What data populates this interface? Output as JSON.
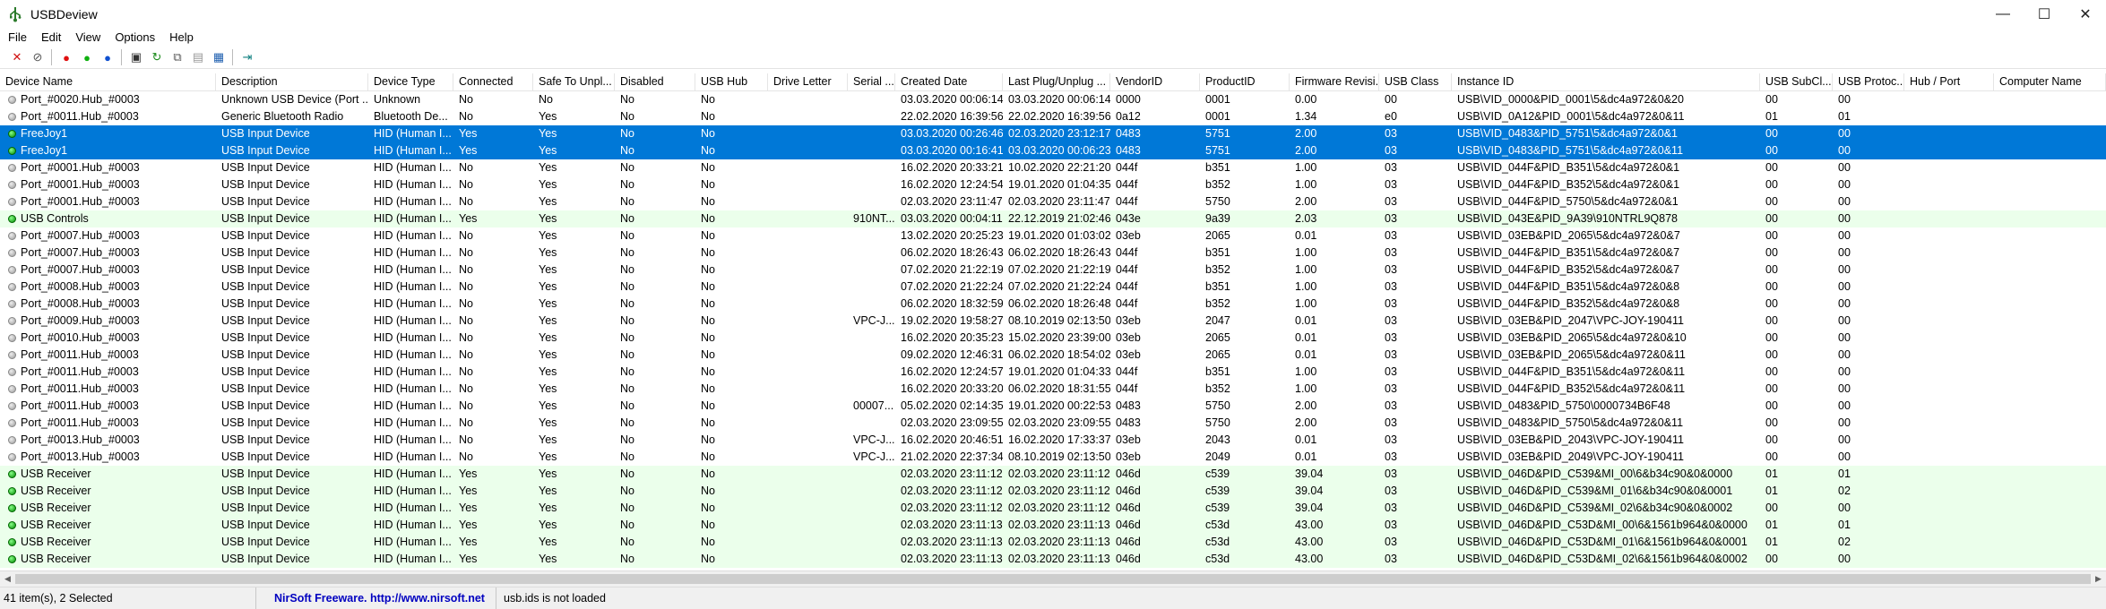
{
  "window": {
    "title": "USBDeview",
    "minimize": "—",
    "maximize": "☐",
    "close": "✕"
  },
  "menu": [
    "File",
    "Edit",
    "View",
    "Options",
    "Help"
  ],
  "toolbar": [
    {
      "name": "delete-icon",
      "glyph": "✕",
      "color": "#d01010"
    },
    {
      "name": "uninstall-icon",
      "glyph": "⊘",
      "color": "#555"
    },
    {
      "name": "disconnect-red-icon",
      "glyph": "●",
      "color": "#e01010"
    },
    {
      "name": "enable-green-icon",
      "glyph": "●",
      "color": "#10b010"
    },
    {
      "name": "blue-dot-icon",
      "glyph": "●",
      "color": "#1050d0"
    },
    {
      "name": "save-icon",
      "glyph": "▣",
      "color": "#333"
    },
    {
      "name": "refresh-icon",
      "glyph": "↻",
      "color": "#1a8a1a"
    },
    {
      "name": "copy-icon",
      "glyph": "⧉",
      "color": "#555"
    },
    {
      "name": "report-icon",
      "glyph": "▤",
      "color": "#999"
    },
    {
      "name": "properties-icon",
      "glyph": "▦",
      "color": "#2060b0"
    },
    {
      "name": "exit-icon",
      "glyph": "⇥",
      "color": "#108080"
    }
  ],
  "columns": [
    "Device Name",
    "Description",
    "Device Type",
    "Connected",
    "Safe To Unpl...",
    "Disabled",
    "USB Hub",
    "Drive Letter",
    "Serial ...",
    "Created Date",
    "Last Plug/Unplug ...",
    "VendorID",
    "ProductID",
    "Firmware Revisi...",
    "USB Class",
    "Instance ID",
    "USB SubCl...",
    "USB Protoc...",
    "Hub / Port",
    "Computer Name"
  ],
  "rows": [
    {
      "status": "gray",
      "style": "",
      "cells": [
        "Port_#0020.Hub_#0003",
        "Unknown USB Device (Port ...",
        "Unknown",
        "No",
        "No",
        "No",
        "No",
        "",
        "",
        "03.03.2020 00:06:14",
        "03.03.2020 00:06:14",
        "0000",
        "0001",
        "0.00",
        "00",
        "USB\\VID_0000&PID_0001\\5&dc4a972&0&20",
        "00",
        "00",
        "",
        ""
      ]
    },
    {
      "status": "gray",
      "style": "",
      "cells": [
        "Port_#0011.Hub_#0003",
        "Generic Bluetooth Radio",
        "Bluetooth De...",
        "No",
        "Yes",
        "No",
        "No",
        "",
        "",
        "22.02.2020 16:39:56",
        "22.02.2020 16:39:56",
        "0a12",
        "0001",
        "1.34",
        "e0",
        "USB\\VID_0A12&PID_0001\\5&dc4a972&0&11",
        "01",
        "01",
        "",
        ""
      ]
    },
    {
      "status": "green",
      "style": "selected",
      "cells": [
        "FreeJoy1",
        "USB Input Device",
        "HID (Human I...",
        "Yes",
        "Yes",
        "No",
        "No",
        "",
        "",
        "03.03.2020 00:26:46",
        "02.03.2020 23:12:17",
        "0483",
        "5751",
        "2.00",
        "03",
        "USB\\VID_0483&PID_5751\\5&dc4a972&0&1",
        "00",
        "00",
        "",
        ""
      ]
    },
    {
      "status": "green",
      "style": "selected",
      "cells": [
        "FreeJoy1",
        "USB Input Device",
        "HID (Human I...",
        "Yes",
        "Yes",
        "No",
        "No",
        "",
        "",
        "03.03.2020 00:16:41",
        "03.03.2020 00:06:23",
        "0483",
        "5751",
        "2.00",
        "03",
        "USB\\VID_0483&PID_5751\\5&dc4a972&0&11",
        "00",
        "00",
        "",
        ""
      ]
    },
    {
      "status": "gray",
      "style": "",
      "cells": [
        "Port_#0001.Hub_#0003",
        "USB Input Device",
        "HID (Human I...",
        "No",
        "Yes",
        "No",
        "No",
        "",
        "",
        "16.02.2020 20:33:21",
        "10.02.2020 22:21:20",
        "044f",
        "b351",
        "1.00",
        "03",
        "USB\\VID_044F&PID_B351\\5&dc4a972&0&1",
        "00",
        "00",
        "",
        ""
      ]
    },
    {
      "status": "gray",
      "style": "",
      "cells": [
        "Port_#0001.Hub_#0003",
        "USB Input Device",
        "HID (Human I...",
        "No",
        "Yes",
        "No",
        "No",
        "",
        "",
        "16.02.2020 12:24:54",
        "19.01.2020 01:04:35",
        "044f",
        "b352",
        "1.00",
        "03",
        "USB\\VID_044F&PID_B352\\5&dc4a972&0&1",
        "00",
        "00",
        "",
        ""
      ]
    },
    {
      "status": "gray",
      "style": "",
      "cells": [
        "Port_#0001.Hub_#0003",
        "USB Input Device",
        "HID (Human I...",
        "No",
        "Yes",
        "No",
        "No",
        "",
        "",
        "02.03.2020 23:11:47",
        "02.03.2020 23:11:47",
        "044f",
        "5750",
        "2.00",
        "03",
        "USB\\VID_044F&PID_5750\\5&dc4a972&0&1",
        "00",
        "00",
        "",
        ""
      ]
    },
    {
      "status": "green",
      "style": "green",
      "cells": [
        "USB Controls",
        "USB Input Device",
        "HID (Human I...",
        "Yes",
        "Yes",
        "No",
        "No",
        "",
        "910NT...",
        "03.03.2020 00:04:11",
        "22.12.2019 21:02:46",
        "043e",
        "9a39",
        "2.03",
        "03",
        "USB\\VID_043E&PID_9A39\\910NTRL9Q878",
        "00",
        "00",
        "",
        ""
      ]
    },
    {
      "status": "gray",
      "style": "",
      "cells": [
        "Port_#0007.Hub_#0003",
        "USB Input Device",
        "HID (Human I...",
        "No",
        "Yes",
        "No",
        "No",
        "",
        "",
        "13.02.2020 20:25:23",
        "19.01.2020 01:03:02",
        "03eb",
        "2065",
        "0.01",
        "03",
        "USB\\VID_03EB&PID_2065\\5&dc4a972&0&7",
        "00",
        "00",
        "",
        ""
      ]
    },
    {
      "status": "gray",
      "style": "",
      "cells": [
        "Port_#0007.Hub_#0003",
        "USB Input Device",
        "HID (Human I...",
        "No",
        "Yes",
        "No",
        "No",
        "",
        "",
        "06.02.2020 18:26:43",
        "06.02.2020 18:26:43",
        "044f",
        "b351",
        "1.00",
        "03",
        "USB\\VID_044F&PID_B351\\5&dc4a972&0&7",
        "00",
        "00",
        "",
        ""
      ]
    },
    {
      "status": "gray",
      "style": "",
      "cells": [
        "Port_#0007.Hub_#0003",
        "USB Input Device",
        "HID (Human I...",
        "No",
        "Yes",
        "No",
        "No",
        "",
        "",
        "07.02.2020 21:22:19",
        "07.02.2020 21:22:19",
        "044f",
        "b352",
        "1.00",
        "03",
        "USB\\VID_044F&PID_B352\\5&dc4a972&0&7",
        "00",
        "00",
        "",
        ""
      ]
    },
    {
      "status": "gray",
      "style": "",
      "cells": [
        "Port_#0008.Hub_#0003",
        "USB Input Device",
        "HID (Human I...",
        "No",
        "Yes",
        "No",
        "No",
        "",
        "",
        "07.02.2020 21:22:24",
        "07.02.2020 21:22:24",
        "044f",
        "b351",
        "1.00",
        "03",
        "USB\\VID_044F&PID_B351\\5&dc4a972&0&8",
        "00",
        "00",
        "",
        ""
      ]
    },
    {
      "status": "gray",
      "style": "",
      "cells": [
        "Port_#0008.Hub_#0003",
        "USB Input Device",
        "HID (Human I...",
        "No",
        "Yes",
        "No",
        "No",
        "",
        "",
        "06.02.2020 18:32:59",
        "06.02.2020 18:26:48",
        "044f",
        "b352",
        "1.00",
        "03",
        "USB\\VID_044F&PID_B352\\5&dc4a972&0&8",
        "00",
        "00",
        "",
        ""
      ]
    },
    {
      "status": "gray",
      "style": "",
      "cells": [
        "Port_#0009.Hub_#0003",
        "USB Input Device",
        "HID (Human I...",
        "No",
        "Yes",
        "No",
        "No",
        "",
        "VPC-J...",
        "19.02.2020 19:58:27",
        "08.10.2019 02:13:50",
        "03eb",
        "2047",
        "0.01",
        "03",
        "USB\\VID_03EB&PID_2047\\VPC-JOY-190411",
        "00",
        "00",
        "",
        ""
      ]
    },
    {
      "status": "gray",
      "style": "",
      "cells": [
        "Port_#0010.Hub_#0003",
        "USB Input Device",
        "HID (Human I...",
        "No",
        "Yes",
        "No",
        "No",
        "",
        "",
        "16.02.2020 20:35:23",
        "15.02.2020 23:39:00",
        "03eb",
        "2065",
        "0.01",
        "03",
        "USB\\VID_03EB&PID_2065\\5&dc4a972&0&10",
        "00",
        "00",
        "",
        ""
      ]
    },
    {
      "status": "gray",
      "style": "",
      "cells": [
        "Port_#0011.Hub_#0003",
        "USB Input Device",
        "HID (Human I...",
        "No",
        "Yes",
        "No",
        "No",
        "",
        "",
        "09.02.2020 12:46:31",
        "06.02.2020 18:54:02",
        "03eb",
        "2065",
        "0.01",
        "03",
        "USB\\VID_03EB&PID_2065\\5&dc4a972&0&11",
        "00",
        "00",
        "",
        ""
      ]
    },
    {
      "status": "gray",
      "style": "",
      "cells": [
        "Port_#0011.Hub_#0003",
        "USB Input Device",
        "HID (Human I...",
        "No",
        "Yes",
        "No",
        "No",
        "",
        "",
        "16.02.2020 12:24:57",
        "19.01.2020 01:04:33",
        "044f",
        "b351",
        "1.00",
        "03",
        "USB\\VID_044F&PID_B351\\5&dc4a972&0&11",
        "00",
        "00",
        "",
        ""
      ]
    },
    {
      "status": "gray",
      "style": "",
      "cells": [
        "Port_#0011.Hub_#0003",
        "USB Input Device",
        "HID (Human I...",
        "No",
        "Yes",
        "No",
        "No",
        "",
        "",
        "16.02.2020 20:33:20",
        "06.02.2020 18:31:55",
        "044f",
        "b352",
        "1.00",
        "03",
        "USB\\VID_044F&PID_B352\\5&dc4a972&0&11",
        "00",
        "00",
        "",
        ""
      ]
    },
    {
      "status": "gray",
      "style": "",
      "cells": [
        "Port_#0011.Hub_#0003",
        "USB Input Device",
        "HID (Human I...",
        "No",
        "Yes",
        "No",
        "No",
        "",
        "00007...",
        "05.02.2020 02:14:35",
        "19.01.2020 00:22:53",
        "0483",
        "5750",
        "2.00",
        "03",
        "USB\\VID_0483&PID_5750\\0000734B6F48",
        "00",
        "00",
        "",
        ""
      ]
    },
    {
      "status": "gray",
      "style": "",
      "cells": [
        "Port_#0011.Hub_#0003",
        "USB Input Device",
        "HID (Human I...",
        "No",
        "Yes",
        "No",
        "No",
        "",
        "",
        "02.03.2020 23:09:55",
        "02.03.2020 23:09:55",
        "0483",
        "5750",
        "2.00",
        "03",
        "USB\\VID_0483&PID_5750\\5&dc4a972&0&11",
        "00",
        "00",
        "",
        ""
      ]
    },
    {
      "status": "gray",
      "style": "",
      "cells": [
        "Port_#0013.Hub_#0003",
        "USB Input Device",
        "HID (Human I...",
        "No",
        "Yes",
        "No",
        "No",
        "",
        "VPC-J...",
        "16.02.2020 20:46:51",
        "16.02.2020 17:33:37",
        "03eb",
        "2043",
        "0.01",
        "03",
        "USB\\VID_03EB&PID_2043\\VPC-JOY-190411",
        "00",
        "00",
        "",
        ""
      ]
    },
    {
      "status": "gray",
      "style": "",
      "cells": [
        "Port_#0013.Hub_#0003",
        "USB Input Device",
        "HID (Human I...",
        "No",
        "Yes",
        "No",
        "No",
        "",
        "VPC-J...",
        "21.02.2020 22:37:34",
        "08.10.2019 02:13:50",
        "03eb",
        "2049",
        "0.01",
        "03",
        "USB\\VID_03EB&PID_2049\\VPC-JOY-190411",
        "00",
        "00",
        "",
        ""
      ]
    },
    {
      "status": "green",
      "style": "green",
      "cells": [
        "USB Receiver",
        "USB Input Device",
        "HID (Human I...",
        "Yes",
        "Yes",
        "No",
        "No",
        "",
        "",
        "02.03.2020 23:11:12",
        "02.03.2020 23:11:12",
        "046d",
        "c539",
        "39.04",
        "03",
        "USB\\VID_046D&PID_C539&MI_00\\6&b34c90&0&0000",
        "01",
        "01",
        "",
        ""
      ]
    },
    {
      "status": "green",
      "style": "green",
      "cells": [
        "USB Receiver",
        "USB Input Device",
        "HID (Human I...",
        "Yes",
        "Yes",
        "No",
        "No",
        "",
        "",
        "02.03.2020 23:11:12",
        "02.03.2020 23:11:12",
        "046d",
        "c539",
        "39.04",
        "03",
        "USB\\VID_046D&PID_C539&MI_01\\6&b34c90&0&0001",
        "01",
        "02",
        "",
        ""
      ]
    },
    {
      "status": "green",
      "style": "green",
      "cells": [
        "USB Receiver",
        "USB Input Device",
        "HID (Human I...",
        "Yes",
        "Yes",
        "No",
        "No",
        "",
        "",
        "02.03.2020 23:11:12",
        "02.03.2020 23:11:12",
        "046d",
        "c539",
        "39.04",
        "03",
        "USB\\VID_046D&PID_C539&MI_02\\6&b34c90&0&0002",
        "00",
        "00",
        "",
        ""
      ]
    },
    {
      "status": "green",
      "style": "green",
      "cells": [
        "USB Receiver",
        "USB Input Device",
        "HID (Human I...",
        "Yes",
        "Yes",
        "No",
        "No",
        "",
        "",
        "02.03.2020 23:11:13",
        "02.03.2020 23:11:13",
        "046d",
        "c53d",
        "43.00",
        "03",
        "USB\\VID_046D&PID_C53D&MI_00\\6&1561b964&0&0000",
        "01",
        "01",
        "",
        ""
      ]
    },
    {
      "status": "green",
      "style": "green",
      "cells": [
        "USB Receiver",
        "USB Input Device",
        "HID (Human I...",
        "Yes",
        "Yes",
        "No",
        "No",
        "",
        "",
        "02.03.2020 23:11:13",
        "02.03.2020 23:11:13",
        "046d",
        "c53d",
        "43.00",
        "03",
        "USB\\VID_046D&PID_C53D&MI_01\\6&1561b964&0&0001",
        "01",
        "02",
        "",
        ""
      ]
    },
    {
      "status": "green",
      "style": "green",
      "cells": [
        "USB Receiver",
        "USB Input Device",
        "HID (Human I...",
        "Yes",
        "Yes",
        "No",
        "No",
        "",
        "",
        "02.03.2020 23:11:13",
        "02.03.2020 23:11:13",
        "046d",
        "c53d",
        "43.00",
        "03",
        "USB\\VID_046D&PID_C53D&MI_02\\6&1561b964&0&0002",
        "00",
        "00",
        "",
        ""
      ]
    }
  ],
  "status": {
    "count": "41 item(s), 2 Selected",
    "link": "NirSoft Freeware.  http://www.nirsoft.net",
    "usbids": "usb.ids is not loaded"
  }
}
